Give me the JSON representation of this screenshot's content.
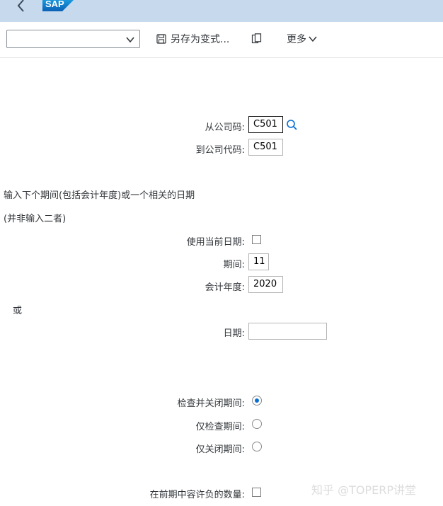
{
  "shell": {
    "logo_text": "SAP",
    "back_icon": "chevron-left-icon"
  },
  "toolbar": {
    "variant_value": "",
    "save_variant_label": "另存为变式...",
    "save_icon": "save-icon",
    "copy_icon": "copy-icon",
    "more_label": "更多"
  },
  "form": {
    "from_company_label": "从公司码:",
    "from_company_value": "C501",
    "to_company_label": "到公司代码:",
    "to_company_value": "C501",
    "instruction_line1": "输入下个期间(包括会计年度)或一个相关的日期",
    "instruction_line2": "(并非输入二者)",
    "use_current_date_label": "使用当前日期:",
    "use_current_date_checked": false,
    "period_label": "期间:",
    "period_value": "11",
    "fiscal_year_label": "会计年度:",
    "fiscal_year_value": "2020",
    "or_label": "或",
    "date_label": "日期:",
    "date_value": "",
    "radio_check_close_label": "检查并关闭期间:",
    "radio_check_only_label": "仅检查期间:",
    "radio_close_only_label": "仅关闭期间:",
    "radio_selected": "check_close",
    "allow_negative_label": "在前期中容许负的数量:",
    "allow_negative_checked": false
  },
  "watermark": "知乎 @TOPERP讲堂"
}
